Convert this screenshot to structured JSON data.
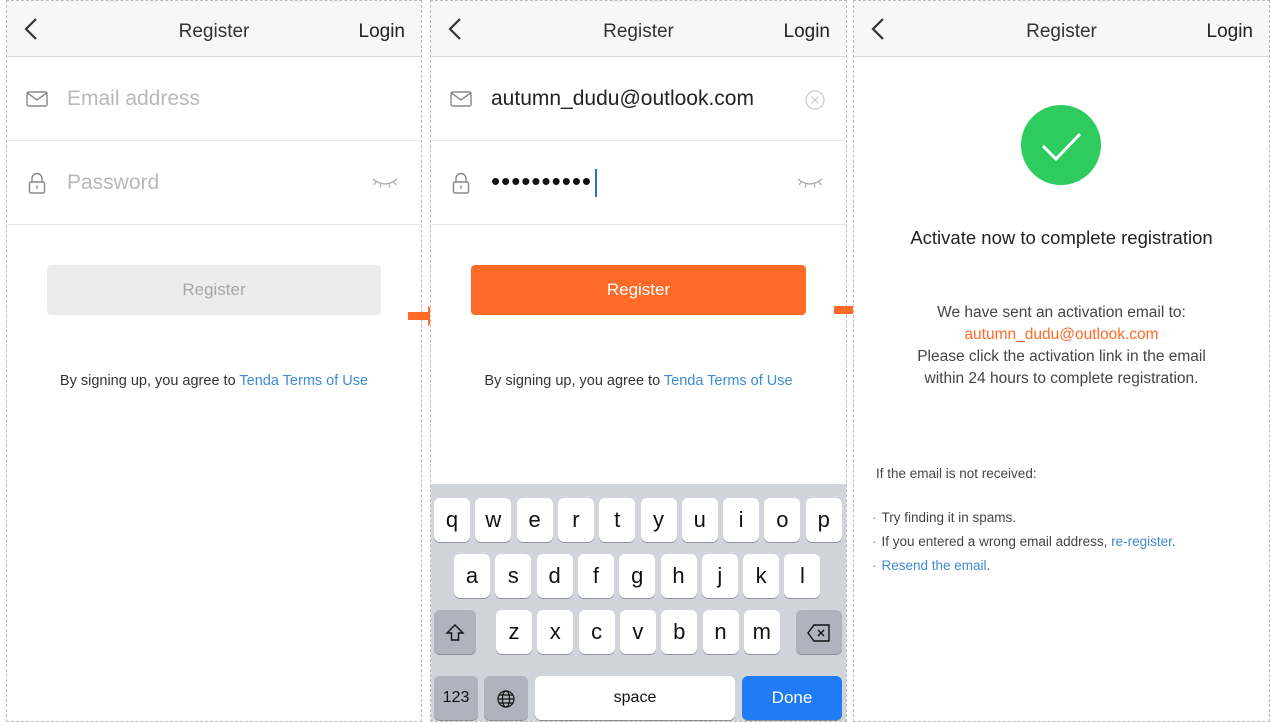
{
  "nav": {
    "title": "Register",
    "login_label": "Login"
  },
  "screen1": {
    "email_placeholder": "Email address",
    "password_placeholder": "Password",
    "register_label": "Register",
    "terms_prefix": "By signing up, you agree to ",
    "terms_link": "Tenda Terms of Use"
  },
  "screen2": {
    "email_value": "autumn_dudu@outlook.com",
    "password_masked": "••••••••••",
    "register_label": "Register",
    "terms_prefix": "By signing up, you agree to ",
    "terms_link": "Tenda Terms of Use",
    "keyboard": {
      "row1": [
        "q",
        "w",
        "e",
        "r",
        "t",
        "y",
        "u",
        "i",
        "o",
        "p"
      ],
      "row2": [
        "a",
        "s",
        "d",
        "f",
        "g",
        "h",
        "j",
        "k",
        "l"
      ],
      "row3": [
        "z",
        "x",
        "c",
        "v",
        "b",
        "n",
        "m"
      ],
      "num_label": "123",
      "space_label": "space",
      "done_label": "Done"
    }
  },
  "screen3": {
    "title": "Activate now to complete registration",
    "sent_line": "We have sent an activation email to:",
    "email": "autumn_dudu@outlook.com",
    "instruction_1": "Please click the activation link in the email",
    "instruction_2": "within 24 hours to complete registration.",
    "help_title": "If the email is not received:",
    "help_1": "Try finding it in spams.",
    "help_2_prefix": "If you entered a wrong email address, ",
    "help_2_link": "re-register",
    "help_2_suffix": ".",
    "help_3_link": "Resend the email",
    "help_3_suffix": "."
  },
  "colors": {
    "accent": "#ff6a26",
    "link": "#3d8ad6",
    "success": "#2ecc5e",
    "keyboard_done": "#1f7cf6"
  }
}
